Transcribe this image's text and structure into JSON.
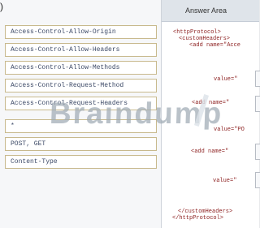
{
  "top_glyph": ")",
  "answer_options": [
    "Access-Control-Allow-Origin",
    "Access-Control-Allow-Headers",
    "Access-Control-Allow-Methods",
    "Access-Control-Request-Method",
    "Access-Control-Request-Headers",
    "*",
    "POST, GET",
    "Content-Type"
  ],
  "answer_area": {
    "title": "Answer Area",
    "code_lines": [
      "<httpProtocol>",
      "<customHeaders>",
      "<add name=\"Acce",
      "value=\"",
      "<add name=\"",
      "value=\"PO",
      "<add name=\"",
      "value=\"",
      "</customHeaders>",
      "</httpProtocol>"
    ]
  },
  "watermark": "Braindump"
}
